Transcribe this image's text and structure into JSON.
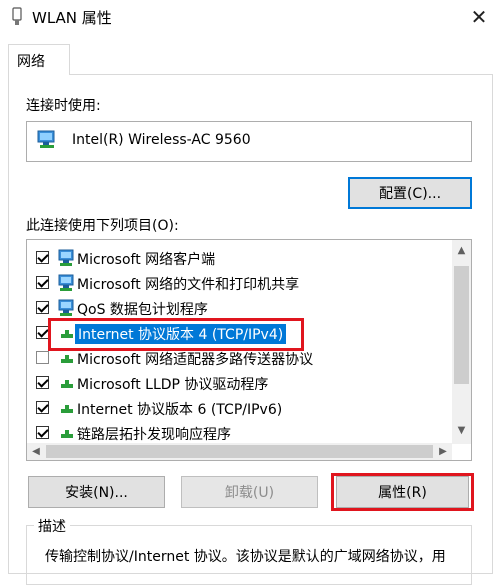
{
  "window": {
    "title": "WLAN 属性",
    "close_glyph": "✕"
  },
  "tabs": [
    {
      "label": "网络"
    }
  ],
  "connect_using": {
    "label": "连接时使用:",
    "adapter_name": "Intel(R) Wireless-AC 9560",
    "adapter_icon": "network-adapter-icon",
    "configure_label": "配置(C)..."
  },
  "items_section": {
    "label": "此连接使用下列项目(O):",
    "items": [
      {
        "label": "Microsoft 网络客户端",
        "checked": true,
        "icon": "network-client-icon",
        "selected": false
      },
      {
        "label": "Microsoft 网络的文件和打印机共享",
        "checked": true,
        "icon": "file-printer-sharing-icon",
        "selected": false
      },
      {
        "label": "QoS 数据包计划程序",
        "checked": true,
        "icon": "qos-scheduler-icon",
        "selected": false
      },
      {
        "label": "Internet 协议版本 4 (TCP/IPv4)",
        "checked": true,
        "icon": "protocol-icon",
        "selected": true
      },
      {
        "label": "Microsoft 网络适配器多路传送器协议",
        "checked": false,
        "icon": "protocol-icon",
        "selected": false
      },
      {
        "label": "Microsoft LLDP 协议驱动程序",
        "checked": true,
        "icon": "protocol-icon",
        "selected": false
      },
      {
        "label": "Internet 协议版本 6 (TCP/IPv6)",
        "checked": true,
        "icon": "protocol-icon",
        "selected": false
      },
      {
        "label": "链路层拓扑发现响应程序",
        "checked": true,
        "icon": "protocol-icon",
        "selected": false
      }
    ]
  },
  "buttons": {
    "install": "安装(N)...",
    "uninstall": "卸载(U)",
    "properties": "属性(R)"
  },
  "description": {
    "title": "描述",
    "text": "传输控制协议/Internet 协议。该协议是默认的广域网络协议，用"
  },
  "colors": {
    "selection": "#0078d7",
    "highlight_border": "#e0151e"
  }
}
